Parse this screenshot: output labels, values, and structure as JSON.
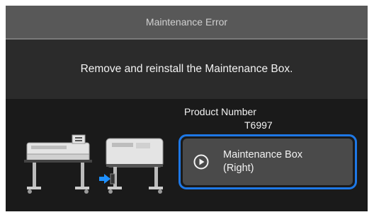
{
  "header": {
    "title": "Maintenance Error"
  },
  "message": {
    "text": "Remove and reinstall the Maintenance Box."
  },
  "product": {
    "label": "Product Number",
    "number": "T6997"
  },
  "button": {
    "line1": "Maintenance Box",
    "line2": "(Right)",
    "icon": "play-circle-icon"
  },
  "colors": {
    "highlight": "#1e78e6",
    "arrow": "#1e90ff"
  }
}
